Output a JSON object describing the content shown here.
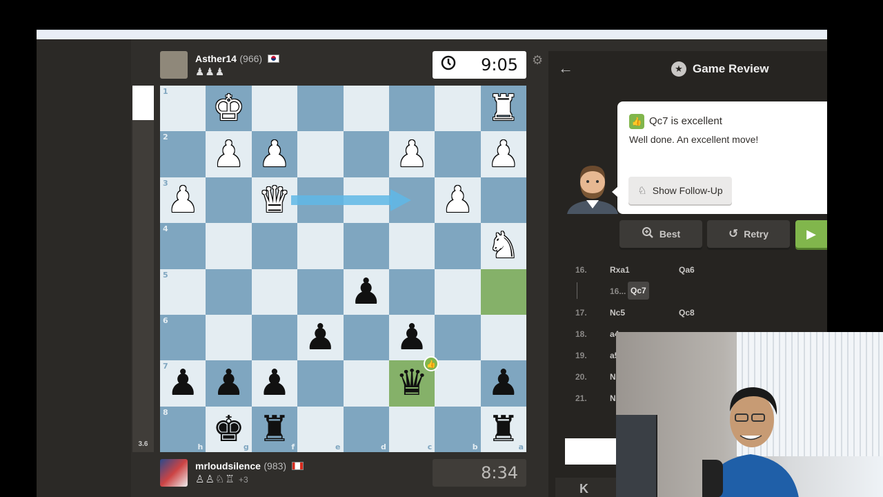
{
  "players": {
    "top": {
      "name": "Asther14",
      "rating": "(966)",
      "captured": "♟♟♟",
      "clock": "9:05"
    },
    "bottom": {
      "name": "mrloudsilence",
      "rating": "(983)",
      "captured": "♙♙♘♖",
      "advantage": "+3",
      "clock": "8:34"
    }
  },
  "eval": {
    "score": "3.6"
  },
  "board": {
    "ranks": [
      "1",
      "2",
      "3",
      "4",
      "5",
      "6",
      "7",
      "8"
    ],
    "files": [
      "h",
      "g",
      "f",
      "e",
      "d",
      "c",
      "b",
      "a"
    ],
    "rows": [
      [
        "",
        "♚",
        "",
        "",
        "",
        "",
        "",
        "♜"
      ],
      [
        "",
        "♟",
        "♟",
        "",
        "",
        "♟",
        "",
        "♟"
      ],
      [
        "♟",
        "",
        "♛",
        "",
        "",
        "",
        "♟",
        ""
      ],
      [
        "",
        "",
        "",
        "",
        "",
        "",
        "",
        "♞"
      ],
      [
        "",
        "",
        "",
        "",
        "♟",
        "",
        "",
        ""
      ],
      [
        "",
        "",
        "",
        "♟",
        "",
        "♟",
        "",
        ""
      ],
      [
        "♟",
        "♟",
        "♟",
        "",
        "",
        "♛",
        "",
        "♟"
      ],
      [
        "",
        "♚",
        "♜",
        "",
        "",
        "",
        "",
        "♜"
      ]
    ],
    "colors": [
      [
        "",
        "w",
        "",
        "",
        "",
        "",
        "",
        "w"
      ],
      [
        "",
        "w",
        "w",
        "",
        "",
        "w",
        "",
        "w"
      ],
      [
        "w",
        "",
        "w",
        "",
        "",
        "",
        "w",
        ""
      ],
      [
        "",
        "",
        "",
        "",
        "",
        "",
        "",
        "w"
      ],
      [
        "",
        "",
        "",
        "",
        "b",
        "",
        "",
        ""
      ],
      [
        "",
        "",
        "",
        "b",
        "",
        "b",
        "",
        ""
      ],
      [
        "b",
        "b",
        "b",
        "",
        "",
        "b",
        "",
        "b"
      ],
      [
        "",
        "b",
        "b",
        "",
        "",
        "",
        "",
        "b"
      ]
    ],
    "highlighted": [
      [
        4,
        7
      ],
      [
        6,
        5
      ]
    ],
    "badge_square": [
      6,
      5
    ],
    "arrow_color": "#5fb7e6"
  },
  "review": {
    "title": "Game Review",
    "move_quality": "Qc7 is excellent",
    "feedback": "Well done. An excellent move!",
    "follow_up_label": "Show Follow-Up",
    "best_label": "Best",
    "retry_label": "Retry"
  },
  "moves": [
    {
      "num": "16.",
      "white": "Rxa1",
      "black": "Qa6"
    },
    {
      "variation": true,
      "num": "16...",
      "move": "Qc7"
    },
    {
      "num": "17.",
      "white": "Nc5",
      "black": "Qc8"
    },
    {
      "num": "18.",
      "white": "a4",
      "black": ""
    },
    {
      "num": "19.",
      "white": "a5",
      "black": ""
    },
    {
      "num": "20.",
      "white": "N",
      "black": ""
    },
    {
      "num": "21.",
      "white": "N",
      "black": ""
    }
  ],
  "colors": {
    "accent_green": "#81b64c",
    "light_square": "#e4edf2",
    "dark_square": "#7fa6c0",
    "highlight": "#85b169"
  },
  "icons": {
    "clock": "clock-icon",
    "gear": "gear-icon",
    "back": "back-arrow-icon",
    "star": "star-icon",
    "thumb": "thumbs-up-icon",
    "follow_up": "follow-up-icon",
    "best": "magnifier-icon",
    "retry": "retry-icon",
    "next": "play-icon",
    "first": "first-move-icon"
  }
}
